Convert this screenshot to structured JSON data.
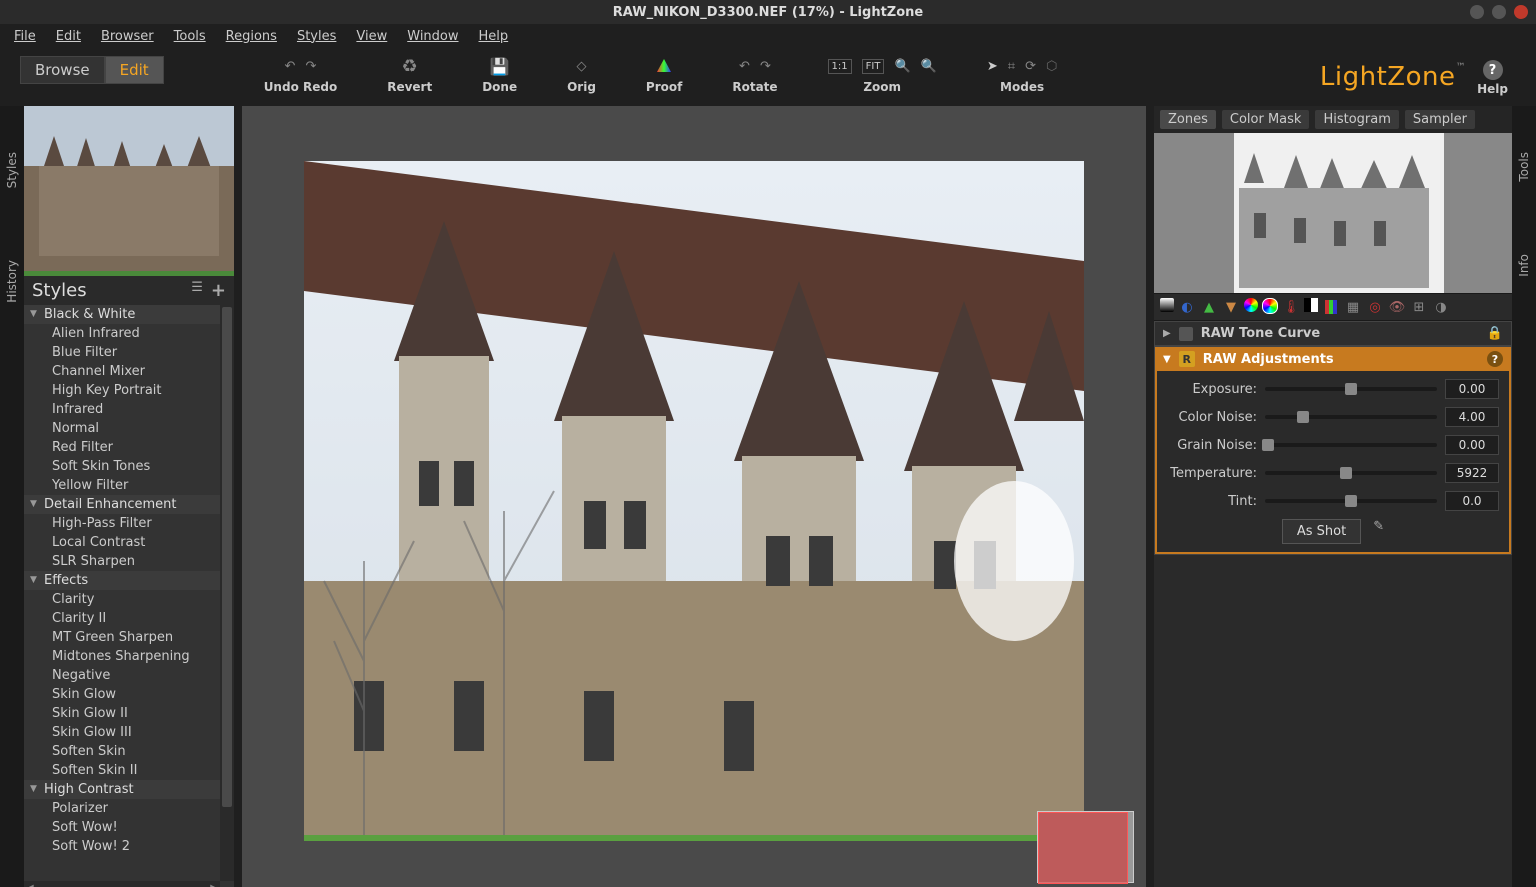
{
  "window": {
    "title": "RAW_NIKON_D3300.NEF (17%) - LightZone"
  },
  "menu": {
    "file": "File",
    "edit": "Edit",
    "browser": "Browser",
    "tools": "Tools",
    "regions": "Regions",
    "styles": "Styles",
    "view": "View",
    "window": "Window",
    "help": "Help"
  },
  "mode": {
    "browse": "Browse",
    "edit": "Edit"
  },
  "toolbar": {
    "undoRedo": "Undo Redo",
    "revert": "Revert",
    "done": "Done",
    "orig": "Orig",
    "proof": "Proof",
    "rotate": "Rotate",
    "zoom": "Zoom",
    "modes": "Modes",
    "zoom_1_1": "1:1",
    "zoom_fit": "FIT"
  },
  "brand": {
    "name": "LightZone",
    "tm": "™",
    "help": "Help"
  },
  "leftTabs": {
    "styles": "Styles",
    "history": "History"
  },
  "rightTabs": {
    "tools": "Tools",
    "info": "Info"
  },
  "styles": {
    "title": "Styles",
    "groups": [
      {
        "name": "Black & White",
        "items": [
          "Alien Infrared",
          "Blue Filter",
          "Channel Mixer",
          "High Key Portrait",
          "Infrared",
          "Normal",
          "Red Filter",
          "Soft Skin Tones",
          "Yellow Filter"
        ]
      },
      {
        "name": "Detail Enhancement",
        "items": [
          "High-Pass Filter",
          "Local Contrast",
          "SLR Sharpen"
        ]
      },
      {
        "name": "Effects",
        "items": [
          "Clarity",
          "Clarity II",
          "MT Green Sharpen",
          "Midtones Sharpening",
          "Negative",
          "Skin Glow",
          "Skin Glow II",
          "Skin Glow III",
          "Soften Skin",
          "Soften Skin II"
        ]
      },
      {
        "name": "High Contrast",
        "items": [
          "Polarizer",
          "Soft Wow!",
          "Soft Wow! 2"
        ]
      }
    ]
  },
  "viewTabs": {
    "zones": "Zones",
    "colorMask": "Color Mask",
    "histogram": "Histogram",
    "sampler": "Sampler"
  },
  "stack": {
    "toneCurve": "RAW Tone Curve",
    "rawAdj": "RAW Adjustments",
    "exposure": {
      "label": "Exposure:",
      "value": "0.00",
      "pos": 50
    },
    "colorNoise": {
      "label": "Color Noise:",
      "value": "4.00",
      "pos": 22
    },
    "grainNoise": {
      "label": "Grain Noise:",
      "value": "0.00",
      "pos": 2
    },
    "temperature": {
      "label": "Temperature:",
      "value": "5922",
      "pos": 47
    },
    "tint": {
      "label": "Tint:",
      "value": "0.0",
      "pos": 50
    },
    "asShot": "As Shot"
  }
}
